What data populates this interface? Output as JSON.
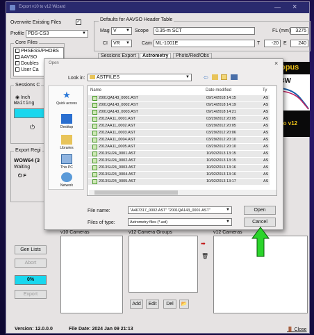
{
  "window": {
    "title": "Export v10 to v12 Wizard",
    "minimize": "—",
    "close": "×"
  },
  "left": {
    "overwrite_label": "Overwrite Existing Files",
    "overwrite_checked": "✓",
    "profile_label": "Profile",
    "profile_value": "PDS-CS3",
    "core_files_title": "Core Files",
    "core_files": [
      "PHSESS/PHOBS",
      "AAVSO",
      "Doubles",
      "User Ca"
    ],
    "sessions_title": "Sessions C",
    "sessions_radio": "Inch",
    "sessions_status": "Waiting",
    "export_title": "Export Regi",
    "export_value": "WOW64 (3",
    "export_status": "Waiting",
    "export_radio": "F",
    "gen_lists": "Gen Lists",
    "abort": "Abort",
    "progress": "0%",
    "export": "Export"
  },
  "header": {
    "group_title": "Defaults for AAVSO Header Table",
    "mag_label": "Mag",
    "mag_value": "V",
    "scope_label": "Scope",
    "scope_value": "0.35-m SCT",
    "fl_label": "FL (mm)",
    "fl_value": "3275",
    "ci_label": "CI",
    "ci_value": "VR",
    "cam_label": "Cam",
    "cam_value": "ML-1001E",
    "t_label": "T",
    "t_value": "-20",
    "e_label": "E",
    "e_value": "240",
    "tabs": [
      "Sessions Export",
      "Astrometry",
      "Photo/Red/Obs"
    ],
    "logo_text1": "opus",
    "logo_text2": "3W",
    "logo_text3": "to v12"
  },
  "lists": {
    "v10_cameras": "v10 Cameras",
    "v12_camera_groups": "v12 Camera Groups",
    "v12_cameras": "v12 Cameras",
    "add": "Add",
    "edit": "Edit",
    "del": "Del"
  },
  "status_bar": {
    "version": "Version: 12.0.0.0",
    "file_date": "File Date: 2024 Jan 09  21:13",
    "close": "Close"
  },
  "dialog": {
    "title": "Open",
    "close": "×",
    "look_in_label": "Look in:",
    "look_in_value": "ASTFILES",
    "places": [
      "Quick access",
      "Desktop",
      "Libraries",
      "This PC",
      "Network"
    ],
    "col_name": "Name",
    "col_date": "Date modified",
    "col_type": "Ty",
    "files": [
      {
        "name": "2001QA143_0001.AST",
        "date": "09/14/2018 14:15",
        "type": "AS"
      },
      {
        "name": "2001QA143_0002.AST",
        "date": "09/14/2018 14:19",
        "type": "AS"
      },
      {
        "name": "2001QA143_0003.AST",
        "date": "09/14/2018 14:21",
        "type": "AS"
      },
      {
        "name": "2012AA11_0001.AST",
        "date": "03/29/2012 20:05",
        "type": "AS"
      },
      {
        "name": "2012AA11_0002.AST",
        "date": "03/29/2012 20:05",
        "type": "AS"
      },
      {
        "name": "2012AA11_0003.AST",
        "date": "03/29/2012 20:06",
        "type": "AS"
      },
      {
        "name": "2012AA11_0004.AST",
        "date": "03/29/2012 20:10",
        "type": "AS"
      },
      {
        "name": "2012AA11_0005.AST",
        "date": "03/29/2012 20:10",
        "type": "AS"
      },
      {
        "name": "2013SU24_0001.AST",
        "date": "10/02/2013 13:15",
        "type": "AS"
      },
      {
        "name": "2013SU24_0002.AST",
        "date": "10/02/2013 13:15",
        "type": "AS"
      },
      {
        "name": "2013SU24_0003.AST",
        "date": "10/02/2013 13:16",
        "type": "AS"
      },
      {
        "name": "2013SU24_0004.AST",
        "date": "10/02/2013 13:16",
        "type": "AS"
      },
      {
        "name": "2013SU24_0005.AST",
        "date": "10/02/2013 13:17",
        "type": "AS"
      }
    ],
    "filename_label": "File name:",
    "filename_value": "\"A467317_0002.AST\" \"2001QA143_0001.AST\"",
    "filetype_label": "Files of type:",
    "filetype_value": "Astrometry files (*.ast)",
    "open": "Open",
    "cancel": "Cancel"
  },
  "colors": {
    "accent_cyan": "#19d7ee",
    "arrow_green": "#2bd42b",
    "bg_purple": "#241265"
  }
}
